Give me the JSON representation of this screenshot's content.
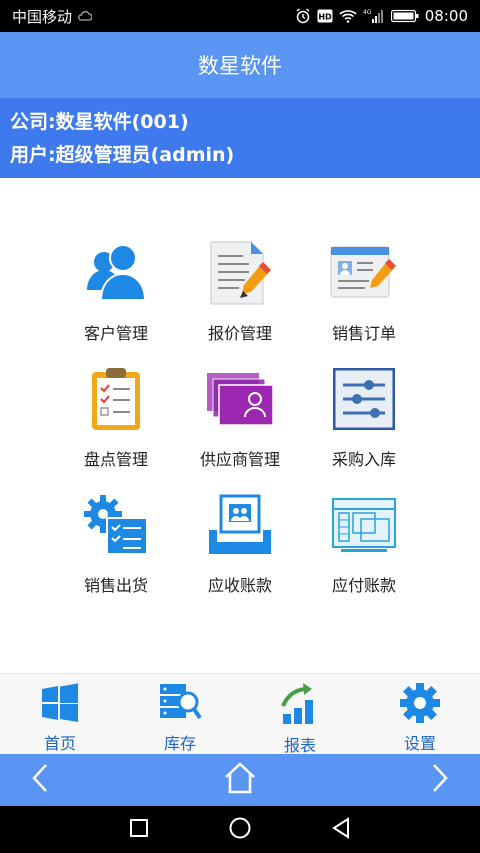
{
  "status": {
    "carrier": "中国移动",
    "network": "4G",
    "time": "08:00"
  },
  "header": {
    "title": "数星软件"
  },
  "info": {
    "company": "公司:数星软件(001)",
    "user": "用户:超级管理员(admin)"
  },
  "menu": [
    {
      "label": "客户管理",
      "icon": "customers-icon"
    },
    {
      "label": "报价管理",
      "icon": "quote-document-icon"
    },
    {
      "label": "销售订单",
      "icon": "sales-order-icon"
    },
    {
      "label": "盘点管理",
      "icon": "clipboard-checklist-icon"
    },
    {
      "label": "供应商管理",
      "icon": "supplier-cards-icon"
    },
    {
      "label": "采购入库",
      "icon": "sliders-icon"
    },
    {
      "label": "销售出货",
      "icon": "gear-checklist-icon"
    },
    {
      "label": "应收账款",
      "icon": "receivable-printer-icon"
    },
    {
      "label": "应付账款",
      "icon": "payable-window-icon"
    }
  ],
  "bottom_nav": [
    {
      "label": "首页",
      "icon": "windows-home-icon"
    },
    {
      "label": "库存",
      "icon": "server-search-icon"
    },
    {
      "label": "报表",
      "icon": "bar-chart-arrow-icon"
    },
    {
      "label": "设置",
      "icon": "gear-icon"
    }
  ],
  "colors": {
    "title_bar": "#5a95f3",
    "info_bar": "#3f79ee",
    "nav_label": "#1f64c8",
    "icon_blue": "#1e88e5"
  }
}
